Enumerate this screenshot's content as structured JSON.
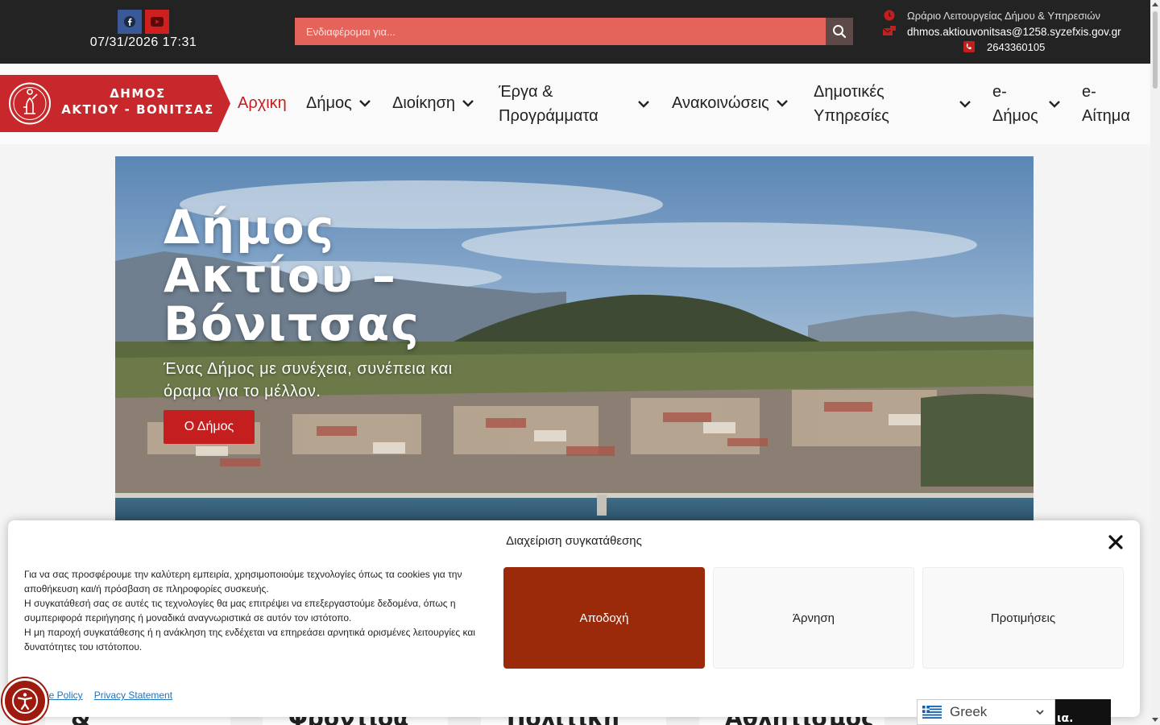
{
  "topbar": {
    "datetime": "07/31/2026 17:31",
    "search_placeholder": "Ενδιαφέρομαι για...",
    "hours_label": "Ωράριο Λειτουργείας Δήμου & Υπηρεσιών",
    "email": "dhmos.aktiouvonitsas@1258.syzefxis.gov.gr",
    "phone": "2643360105",
    "icons": {
      "facebook": "facebook-icon",
      "youtube": "youtube-icon",
      "search": "search-icon",
      "clock": "clock-icon",
      "mail": "mail-icon",
      "phone": "phone-icon"
    }
  },
  "header": {
    "logo_line1": "ΔΗΜΟΣ",
    "logo_line2": "ΑΚΤΙΟΥ - ΒΟΝΙΤΣΑΣ",
    "nav": [
      {
        "label": "Αρχικη",
        "active": true,
        "dropdown": false
      },
      {
        "label": "Δήμος",
        "dropdown": true
      },
      {
        "label": "Διοίκηση",
        "dropdown": true
      },
      {
        "label": "Έργα &",
        "label2": "Προγράμματα",
        "dropdown": true
      },
      {
        "label": "Ανακοινώσεις",
        "dropdown": true
      },
      {
        "label": "Δημοτικές",
        "label2": "Υπηρεσίες",
        "dropdown": true
      },
      {
        "label": "e-",
        "label2": "Δήμος",
        "dropdown": true
      },
      {
        "label": "e-",
        "label2": "Αίτημα",
        "dropdown": false
      }
    ]
  },
  "hero": {
    "title_l1": "Δήμος",
    "title_l2": "Ακτίου –",
    "title_l3": "Βόνιτσας",
    "subtitle": "Ένας Δήμος με συνέχεια, συνέπεια και όραμα για το μέλλον.",
    "button": "Ο Δήμος"
  },
  "cards": {
    "c1": "&",
    "c2": "Φροντίδα",
    "c3": "Πολιτική",
    "c4": "Αθλητισμός",
    "c5": "ια."
  },
  "consent": {
    "title": "Διαχείριση συγκατάθεσης",
    "text_p1": "Για να σας προσφέρουμε την καλύτερη εμπειρία, χρησιμοποιούμε τεχνολογίες όπως τα cookies για την αποθήκευση και/ή πρόσβαση σε πληροφορίες συσκευής.",
    "text_p2": "Η συγκατάθεσή σας σε αυτές τις τεχνολογίες θα μας επιτρέψει να επεξεργαστούμε δεδομένα, όπως η συμπεριφορά περιήγησης ή μοναδικά αναγνωριστικά σε αυτόν τον ιστότοπο.",
    "text_p3": "Η μη παροχή συγκατάθεσης ή η ανάκληση της ενδέχεται να επηρεάσει αρνητικά ορισμένες λειτουργίες και δυνατότητες του ιστότοπου.",
    "accept": "Αποδοχή",
    "deny": "Άρνηση",
    "preferences": "Προτιμήσεις",
    "cookie_policy": "ie Policy",
    "privacy": "Privacy Statement"
  },
  "language": {
    "selected": "Greek"
  },
  "colors": {
    "brand_red": "#c41e1e",
    "accept_btn": "#9b2a0a",
    "search_bg": "#e4635b",
    "topbar_bg": "#232323"
  }
}
